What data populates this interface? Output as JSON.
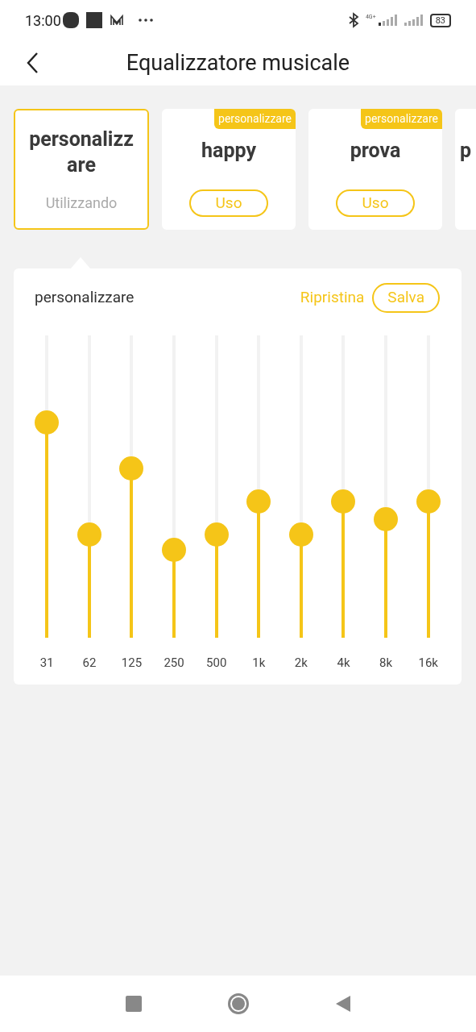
{
  "status_bar": {
    "time": "13:00",
    "network": "4G+",
    "battery": "83"
  },
  "header": {
    "title": "Equalizzatore musicale"
  },
  "presets": [
    {
      "name": "personalizzare",
      "selected": true,
      "status": "Utilizzando"
    },
    {
      "name": "happy",
      "selected": false,
      "badge": "personalizzare",
      "button": "Uso"
    },
    {
      "name": "prova",
      "selected": false,
      "badge": "personalizzare",
      "button": "Uso"
    },
    {
      "name": "p",
      "selected": false
    }
  ],
  "equalizer": {
    "title": "personalizzare",
    "reset": "Ripristina",
    "save": "Salva",
    "bands": [
      {
        "label": "31",
        "level": 0.71
      },
      {
        "label": "62",
        "level": 0.34
      },
      {
        "label": "125",
        "level": 0.56
      },
      {
        "label": "250",
        "level": 0.29
      },
      {
        "label": "500",
        "level": 0.34
      },
      {
        "label": "1k",
        "level": 0.45
      },
      {
        "label": "2k",
        "level": 0.34
      },
      {
        "label": "4k",
        "level": 0.45
      },
      {
        "label": "8k",
        "level": 0.39
      },
      {
        "label": "16k",
        "level": 0.45
      }
    ]
  }
}
